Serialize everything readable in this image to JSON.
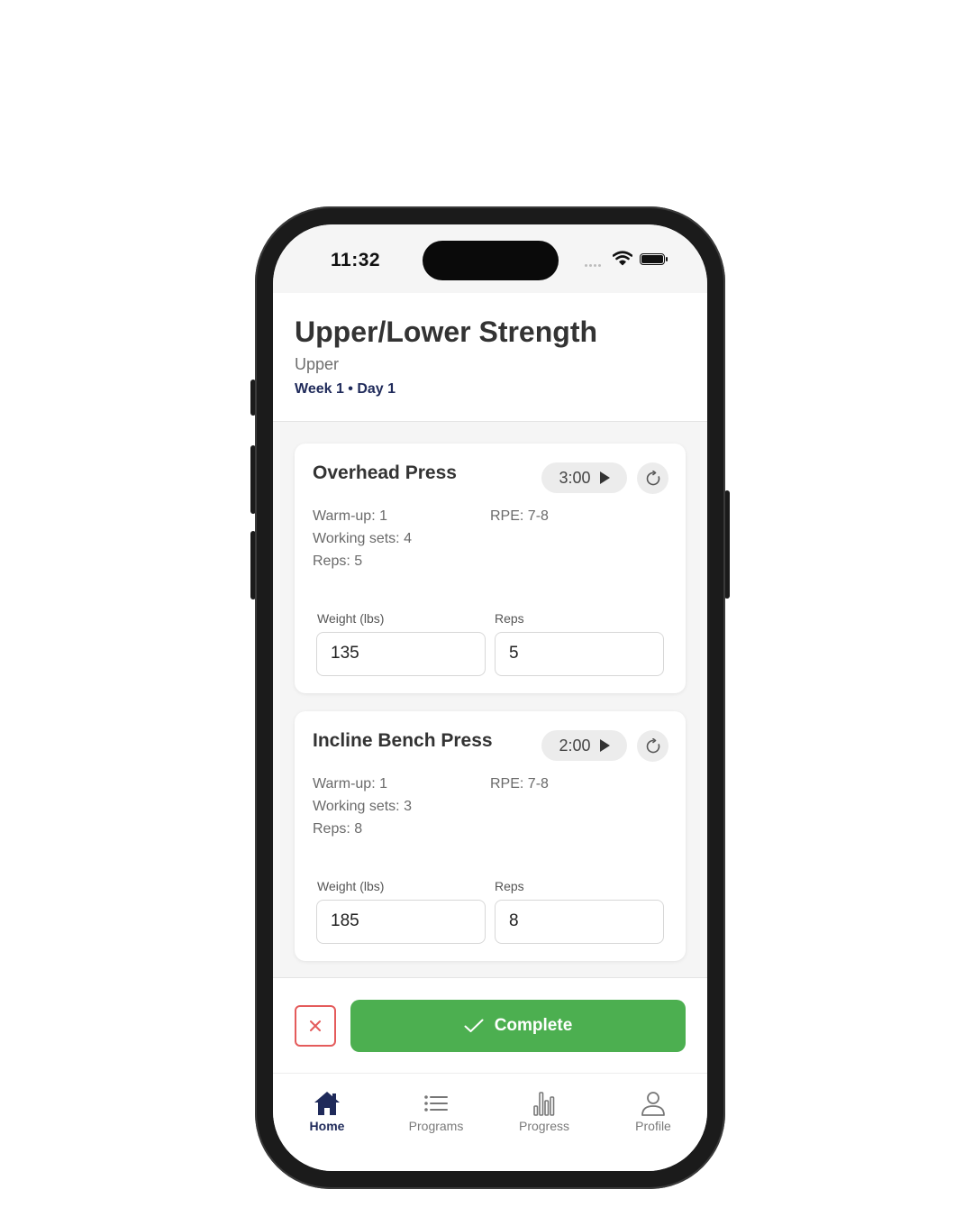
{
  "status_bar": {
    "time": "11:32"
  },
  "header": {
    "title": "Upper/Lower Strength",
    "subtitle": "Upper",
    "week_day": "Week 1 • Day 1"
  },
  "exercises": [
    {
      "name": "Overhead Press",
      "timer": "3:00",
      "warmup": "Warm-up: 1",
      "working_sets": "Working sets: 4",
      "reps_info": "Reps: 5",
      "rpe": "RPE: 7-8",
      "weight_label": "Weight (lbs)",
      "reps_label": "Reps",
      "weight_value": "135",
      "reps_value": "5"
    },
    {
      "name": "Incline Bench Press",
      "timer": "2:00",
      "warmup": "Warm-up: 1",
      "working_sets": "Working sets: 3",
      "reps_info": "Reps: 8",
      "rpe": "RPE: 7-8",
      "weight_label": "Weight (lbs)",
      "reps_label": "Reps",
      "weight_value": "185",
      "reps_value": "8"
    }
  ],
  "actions": {
    "complete_label": "Complete"
  },
  "tabs": [
    {
      "label": "Home",
      "icon": "home-icon",
      "active": true
    },
    {
      "label": "Programs",
      "icon": "list-icon",
      "active": false
    },
    {
      "label": "Progress",
      "icon": "bar-chart-icon",
      "active": false
    },
    {
      "label": "Profile",
      "icon": "person-icon",
      "active": false
    }
  ],
  "colors": {
    "accent_navy": "#1f2a5a",
    "complete_green": "#4caf50",
    "cancel_red": "#e45b5b",
    "background": "#f5f5f5"
  }
}
